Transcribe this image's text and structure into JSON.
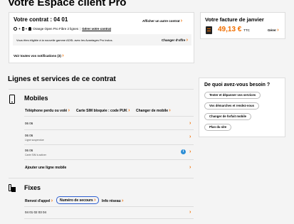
{
  "header": {
    "title": "Votre Espace client Pro"
  },
  "contract_card": {
    "title": "Votre contrat : 04 01",
    "switch_link": "Afficher un autre contrat",
    "offer_label": "Orange Open Pro Fibre 2 lignes",
    "offer_link": "Gérer votre contrat",
    "promo_text": "Vous êtes éligible à la nouvelle gamme ADSL avec les Avantages Pro inclus.",
    "promo_link": "Changer d'offre",
    "notifications_link": "Voir toutes vos notifications (3)"
  },
  "invoice_card": {
    "title": "Votre facture de janvier",
    "amount": "49,13 €",
    "amount_suffix": "TTC",
    "manage_link": "Gérer"
  },
  "lines_section": {
    "title": "Lignes et services de ce contrat"
  },
  "mobiles": {
    "title": "Mobiles",
    "actions": [
      "Téléphone perdu ou volé",
      "Carte SIM bloquée : code PUK",
      "Changer de mobile"
    ],
    "lines": [
      {
        "number": "06 06",
        "status": ""
      },
      {
        "number": "06 06",
        "status": "Ligne suspendue"
      },
      {
        "number": "06 06",
        "status": "Carte SIM à activer"
      }
    ],
    "add_line": "Ajouter une ligne mobile"
  },
  "fixes": {
    "title": "Fixes",
    "actions": [
      "Renvoi d'appel",
      "Numéro de secours",
      "Info réseau"
    ],
    "lines": [
      {
        "number": "04 01 02 03 04"
      }
    ]
  },
  "help_card": {
    "title": "De quoi avez-vous besoin ?",
    "buttons": [
      "Tester et dépanner vos services",
      "Vos démarches et rendez-vous",
      "Changer de forfait mobile",
      "Plan du site"
    ]
  },
  "icons": {
    "chevron": "›",
    "info": "i"
  },
  "colors": {
    "accent": "#f16e00",
    "focus_ring": "#2f5fd0",
    "info": "#2c8ed6"
  }
}
